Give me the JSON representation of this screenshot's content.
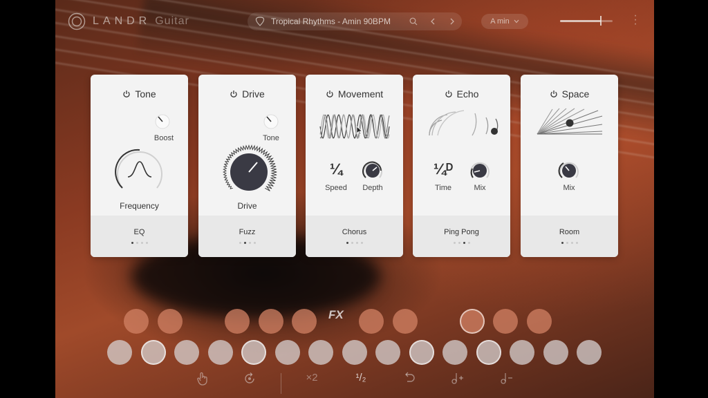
{
  "app": {
    "brand": "LANDR",
    "product": "Guitar"
  },
  "header": {
    "preset_name": "Tropical Rhythms - Amin 90BPM",
    "key": "A min",
    "volume_level": 0.78
  },
  "cards": [
    {
      "title": "Tone",
      "knob_label": "Boost",
      "main_label": "Frequency",
      "footer": "EQ",
      "page": 0,
      "pages": 4
    },
    {
      "title": "Drive",
      "knob_label": "Tone",
      "main_label": "Drive",
      "footer": "Fuzz",
      "page": 1,
      "pages": 4
    },
    {
      "title": "Movement",
      "rate": "¼",
      "rate_label": "Speed",
      "knob_label": "Depth",
      "footer": "Chorus",
      "page": 0,
      "pages": 4
    },
    {
      "title": "Echo",
      "rate": "¼ᴰ",
      "rate_label": "Time",
      "knob_label": "Mix",
      "footer": "Ping Pong",
      "page": 2,
      "pages": 4
    },
    {
      "title": "Space",
      "knob_label": "Mix",
      "footer": "Room",
      "page": 0,
      "pages": 4
    }
  ],
  "pads": {
    "fx_label": "FX"
  },
  "bottom_bar": {
    "multiplier": "×2",
    "division": "¹/₂"
  },
  "colors": {
    "card_bg": "#f3f3f3",
    "pad_orange": "#d28264",
    "pad_grey": "#d7d2d2"
  }
}
